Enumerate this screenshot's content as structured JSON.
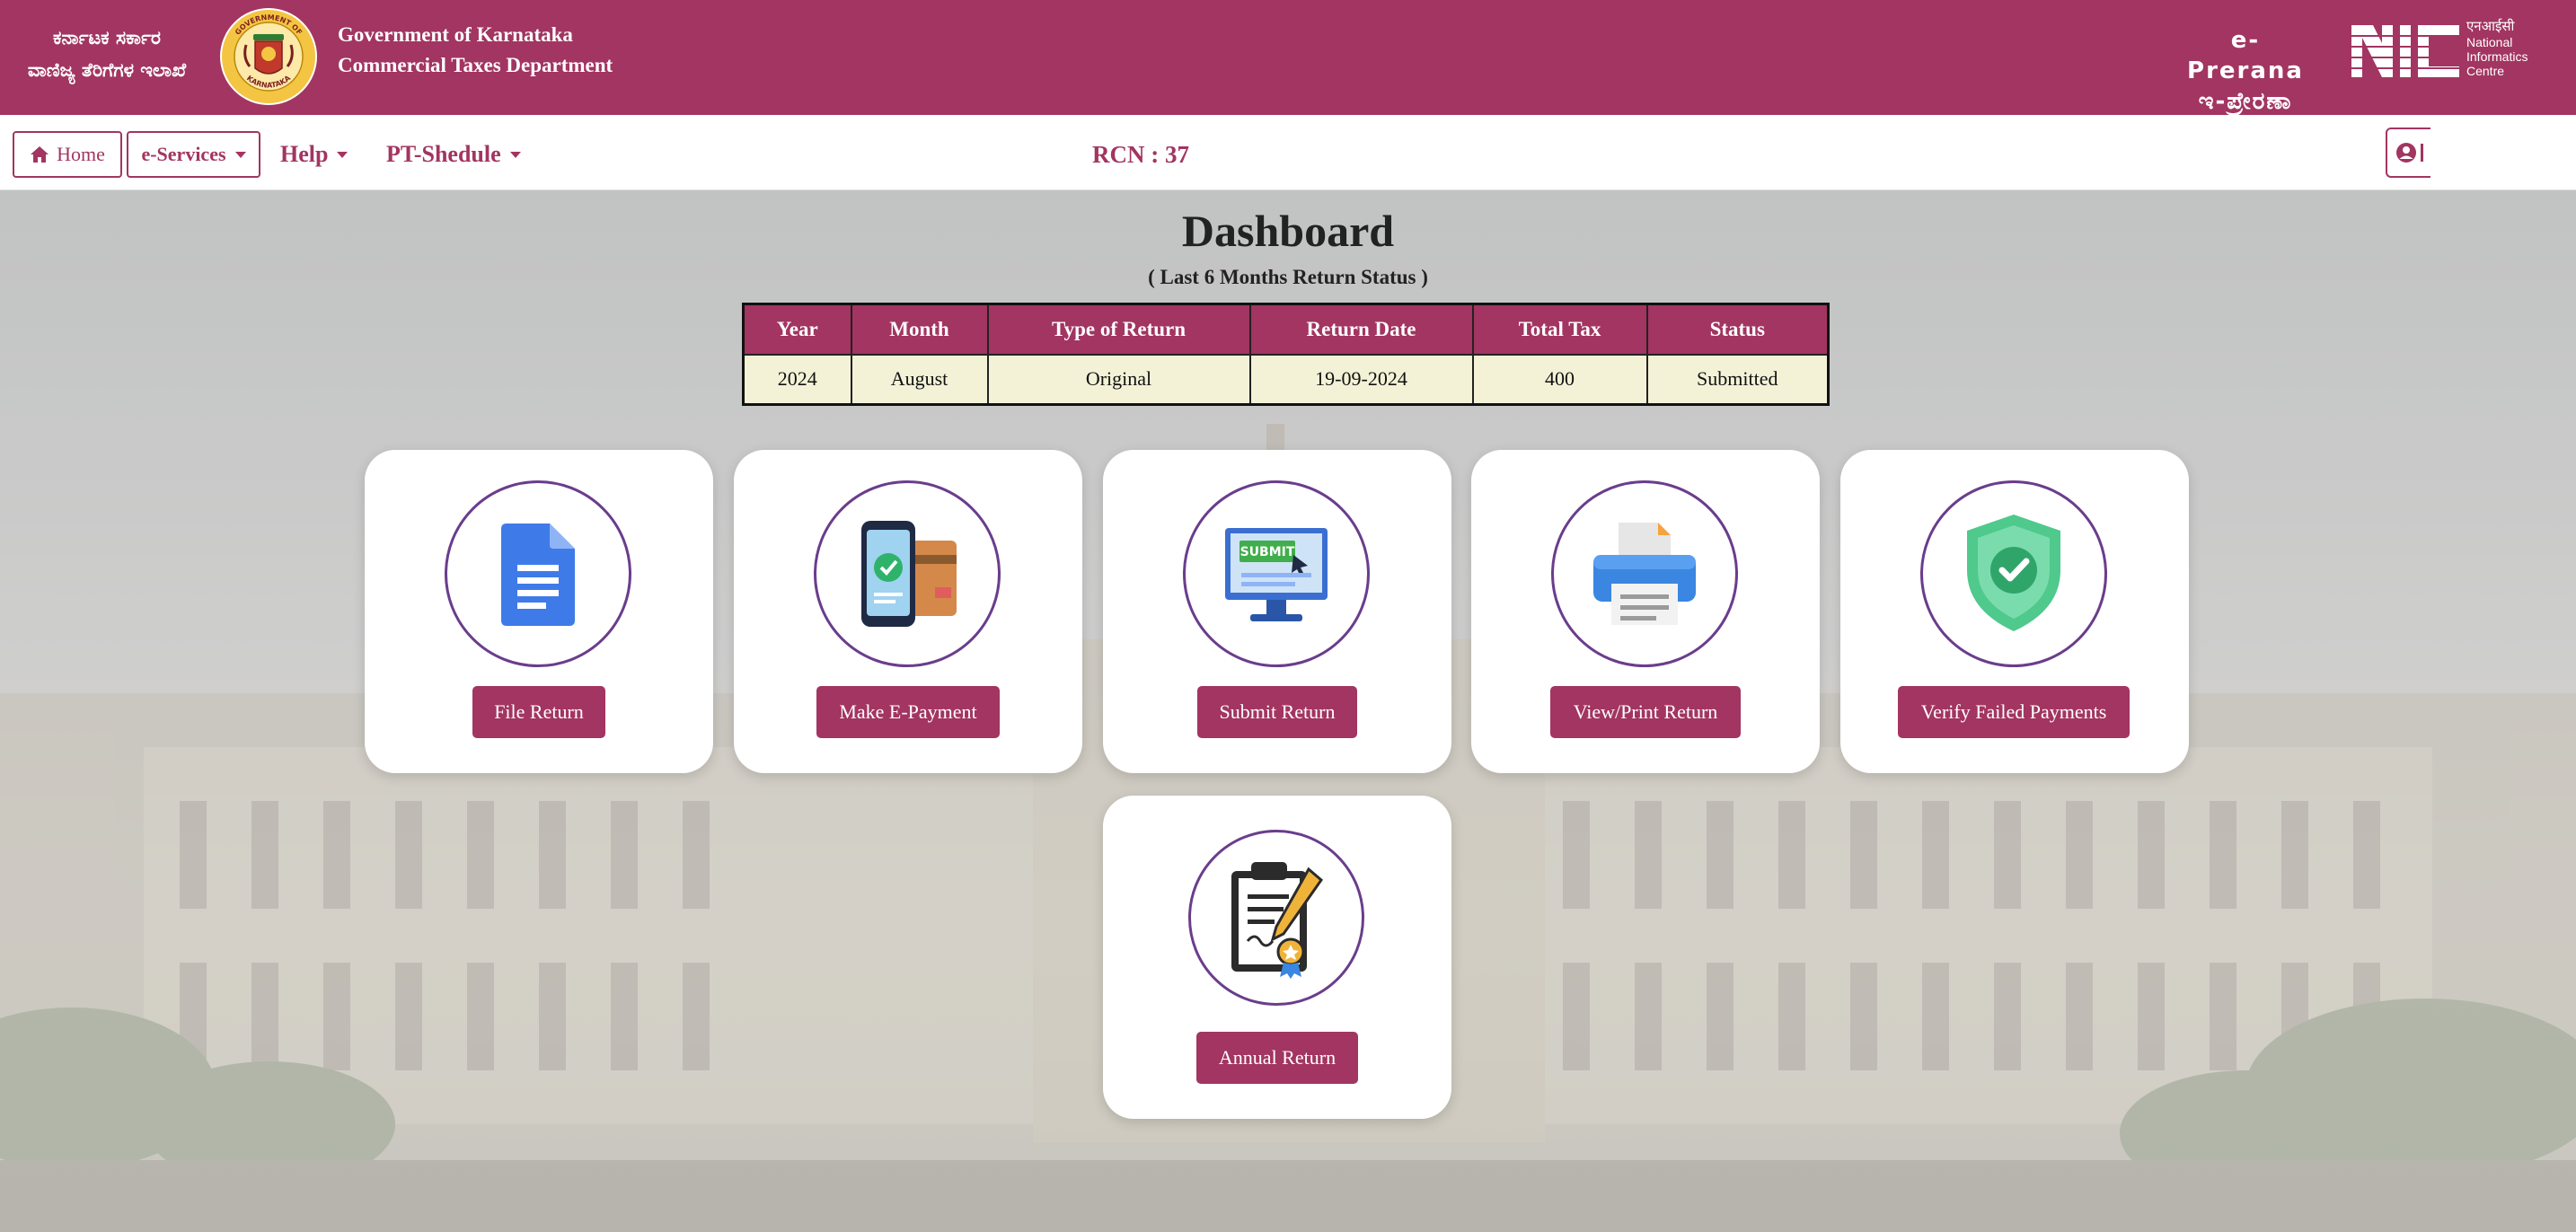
{
  "header": {
    "kannada_line1": "ಕರ್ನಾಟಕ ಸರ್ಕಾರ",
    "kannada_line2": "ವಾಣಿಜ್ಯ ತೆರಿಗೆಗಳ ಇಲಾಖೆ",
    "english_line1": "Government of Karnataka",
    "english_line2": "Commercial Taxes Department",
    "eprerana_line1": "e-Prerana",
    "eprerana_line2": "ಇ-ಪ್ರೇರಣಾ",
    "nic_hindi": "एनआईसी",
    "nic_line1": "National",
    "nic_line2": "Informatics",
    "nic_line3": "Centre",
    "emblem_text_top": "GOVERNMENT OF",
    "emblem_text_bottom": "KARNATAKA",
    "brand_color": "#a23561"
  },
  "navbar": {
    "home_label": "Home",
    "eservices_label": "e-Services",
    "help_label": "Help",
    "ptschedule_label": "PT-Shedule",
    "rcn_text": "RCN : 37"
  },
  "dashboard": {
    "title": "Dashboard",
    "subtitle": "( Last 6 Months Return Status )",
    "columns": [
      "Year",
      "Month",
      "Type of Return",
      "Return Date",
      "Total Tax",
      "Status"
    ],
    "rows": [
      [
        "2024",
        "August",
        "Original",
        "19-09-2024",
        "400",
        "Submitted"
      ]
    ]
  },
  "cards": [
    {
      "label": "File Return",
      "icon": "document-icon"
    },
    {
      "label": "Make E-Payment",
      "icon": "mobile-payment-icon"
    },
    {
      "label": "Submit Return",
      "icon": "submit-monitor-icon"
    },
    {
      "label": "View/Print Return",
      "icon": "printer-icon"
    },
    {
      "label": "Verify Failed Payments",
      "icon": "shield-check-icon"
    },
    {
      "label": "Annual Return",
      "icon": "clipboard-certificate-icon"
    }
  ],
  "submit_screen_text": "SUBMIT"
}
